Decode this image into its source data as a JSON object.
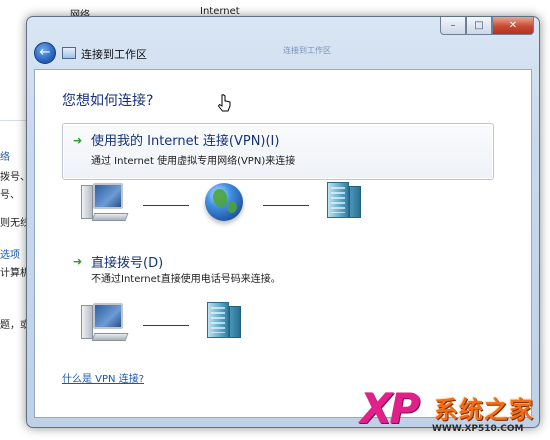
{
  "background": {
    "top_labels": [
      "网络",
      "Internet"
    ],
    "left_fragments": [
      {
        "text": "络",
        "blue": true
      },
      {
        "text": "拨号、",
        "blue": false
      },
      {
        "text": "号、",
        "blue": false
      },
      {
        "text": "则无线",
        "blue": false
      },
      {
        "text": "选项",
        "blue": true
      },
      {
        "text": "计算机",
        "blue": false
      },
      {
        "text": "题，或",
        "blue": false
      }
    ]
  },
  "window": {
    "caption_buttons": {
      "minimize": "–",
      "maximize": "□",
      "close": "✕"
    },
    "title": "连接到工作区",
    "nav_faint_text": "连接到工作区"
  },
  "content": {
    "heading": "您想如何连接?",
    "option_vpn": {
      "arrow": "➜",
      "title": "使用我的 Internet 连接(VPN)(I)",
      "description": "通过 Internet 使用虚拟专用网络(VPN)来连接"
    },
    "option_dialup": {
      "arrow": "➜",
      "title": "直接拨号(D)",
      "description": "不通过Internet直接使用电话号码来连接。"
    },
    "help_link": "什么是 VPN 连接?"
  },
  "watermark": {
    "logo": "XP",
    "name": "系统之家",
    "url": "WWW.XP510.COM"
  },
  "icons": [
    "back-arrow-icon",
    "workplace-icon",
    "computer-icon",
    "globe-icon",
    "server-icon",
    "green-arrow-icon",
    "mouse-cursor-icon"
  ]
}
